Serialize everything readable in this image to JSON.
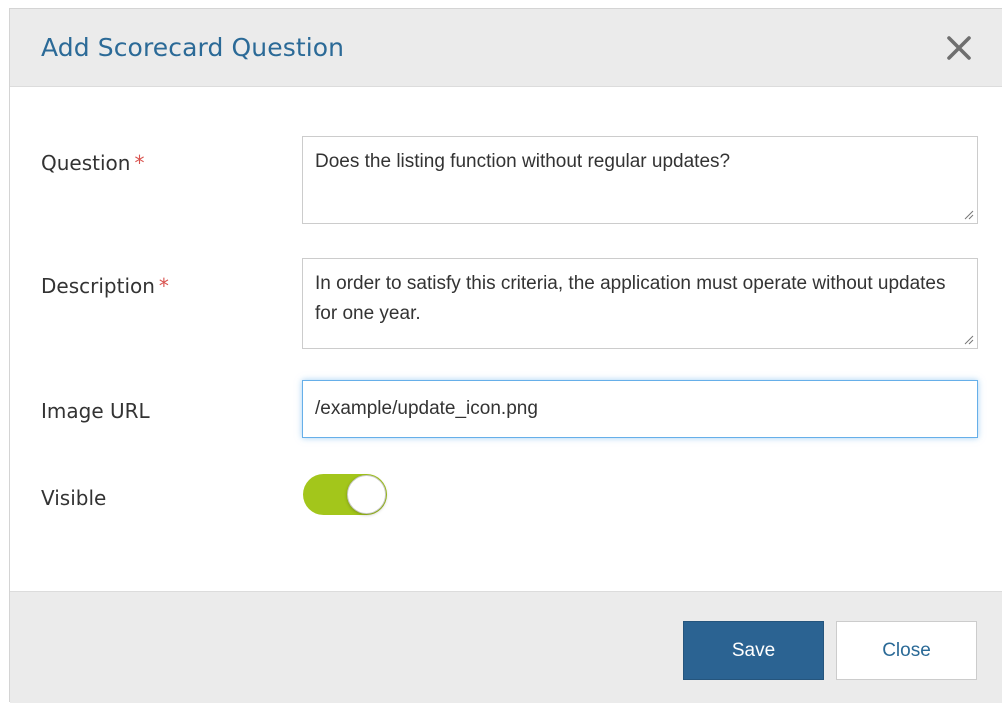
{
  "dialog": {
    "title": "Add Scorecard Question",
    "close_icon": "close-icon"
  },
  "form": {
    "question": {
      "label": "Question",
      "required_mark": "*",
      "value": "Does the listing function without regular updates?"
    },
    "description": {
      "label": "Description",
      "required_mark": "*",
      "value": "In order to satisfy this criteria, the application must operate without updates for one year."
    },
    "image_url": {
      "label": "Image URL",
      "value": "/example/update_icon.png"
    },
    "visible": {
      "label": "Visible",
      "on": true
    }
  },
  "footer": {
    "save_label": "Save",
    "close_label": "Close"
  },
  "colors": {
    "accent": "#2b6a97",
    "save_button": "#2b6392",
    "toggle_on": "#a3c61b",
    "required": "#d9534f",
    "header_bg": "#ebebeb"
  }
}
